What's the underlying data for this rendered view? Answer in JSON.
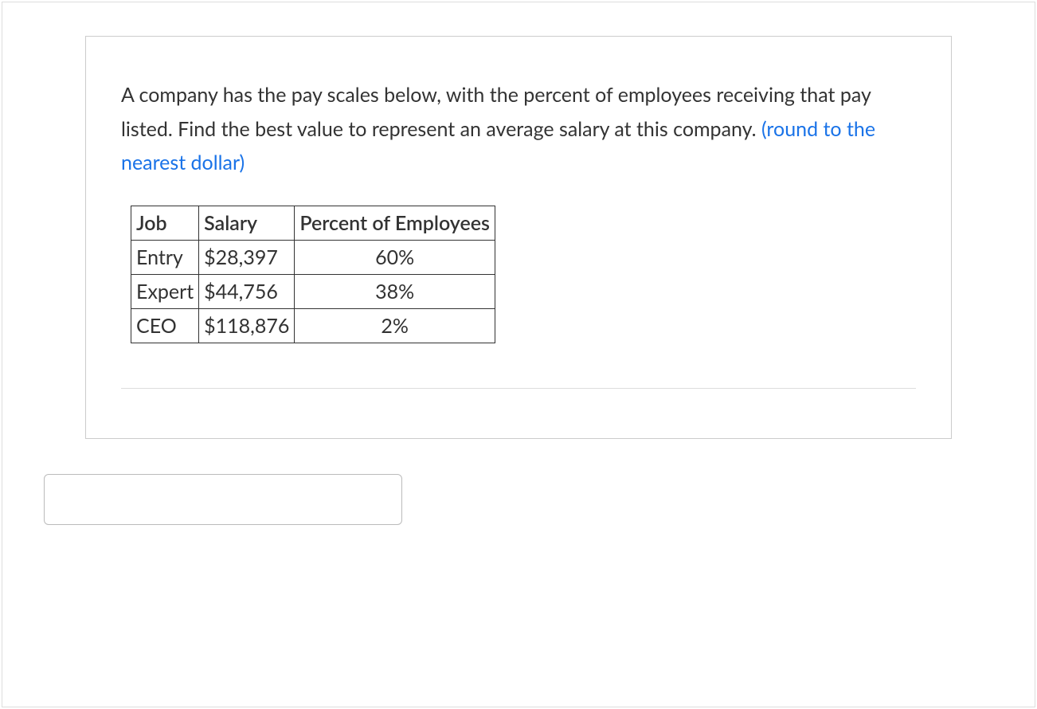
{
  "question": {
    "text_part1": "A company has the pay scales below, with the percent of employees receiving that pay listed. Find the best value to represent an average salary at this company. ",
    "highlight": "(round to the nearest dollar)"
  },
  "table": {
    "headers": {
      "col1": "Job",
      "col2": "Salary",
      "col3": "Percent of Employees"
    },
    "rows": [
      {
        "job": "Entry",
        "salary": "$28,397",
        "percent": "60%"
      },
      {
        "job": "Expert",
        "salary": "$44,756",
        "percent": "38%"
      },
      {
        "job": "CEO",
        "salary": "$118,876",
        "percent": "2%"
      }
    ]
  },
  "answer": {
    "value": "",
    "placeholder": ""
  }
}
